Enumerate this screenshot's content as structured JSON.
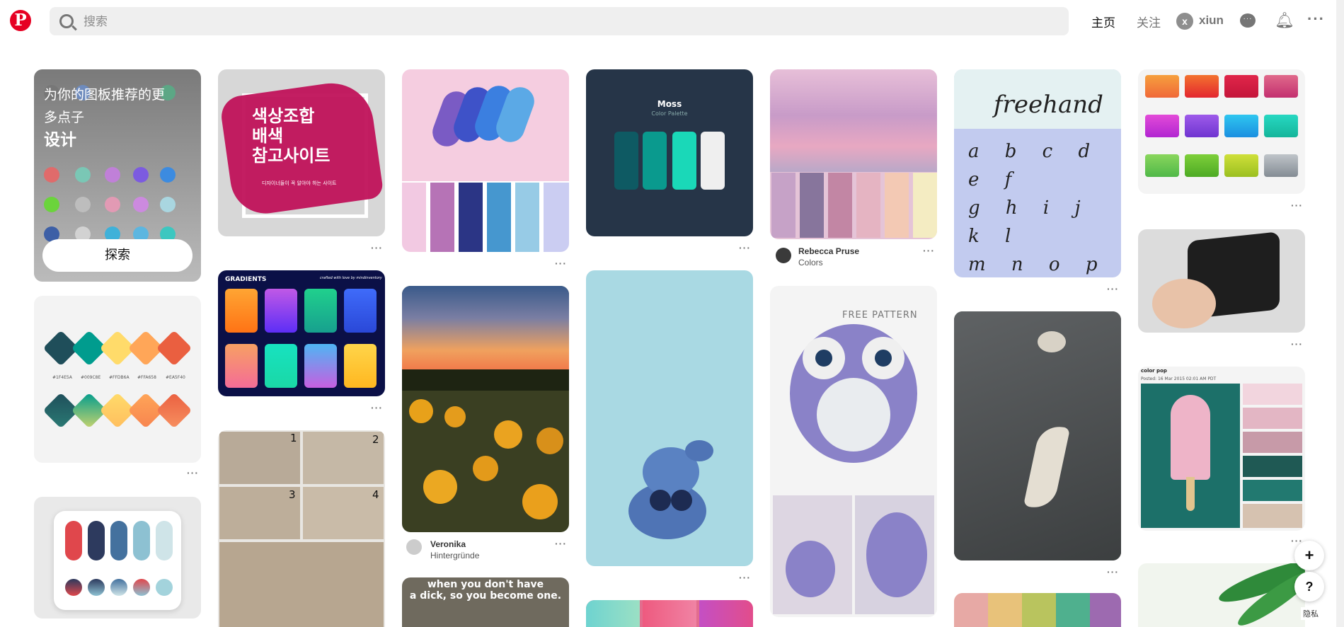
{
  "header": {
    "search_placeholder": "搜索",
    "nav_home": "主页",
    "nav_follow": "关注",
    "avatar_letter": "x",
    "username": "xiun",
    "logo_letter": "P"
  },
  "promo": {
    "line1": "为你的图板推荐的更",
    "line2": "多点子",
    "topic": "设计",
    "explore_button": "探索"
  },
  "pins": {
    "korean_title": "색상조합\n배색\n참고사이트",
    "korean_subtitle": "디자이너들이 꼭 알아야 하는 사이트",
    "gradients_title": "GRADIENTS",
    "gradients_credit": "crafted with love by mindinventory",
    "moss_title": "Moss",
    "moss_subtitle": "Color Palette",
    "diamond_codes": [
      "#1F4E5A",
      "#009C8E",
      "#FFDB6A",
      "#FFA658",
      "#EA5F40"
    ],
    "veronika_name": "Veronika",
    "veronika_board": "Hintergründe",
    "rebecca_name": "Rebecca Pruse",
    "rebecca_board": "Colors",
    "free_pattern": "FREE PATTERN",
    "freehand_title": "freehand",
    "meme_text": "when you don't have\na dick, so you become one.",
    "colorpop_title": "color pop",
    "colorpop_date": "Posted: 16 Mar 2015 02:01 AM PDT",
    "knot_numbers": [
      "1",
      "2",
      "3",
      "4"
    ]
  },
  "floating": {
    "plus": "+",
    "help": "?",
    "privacy": "隐私"
  },
  "colors": {
    "brand": "#e60023"
  }
}
